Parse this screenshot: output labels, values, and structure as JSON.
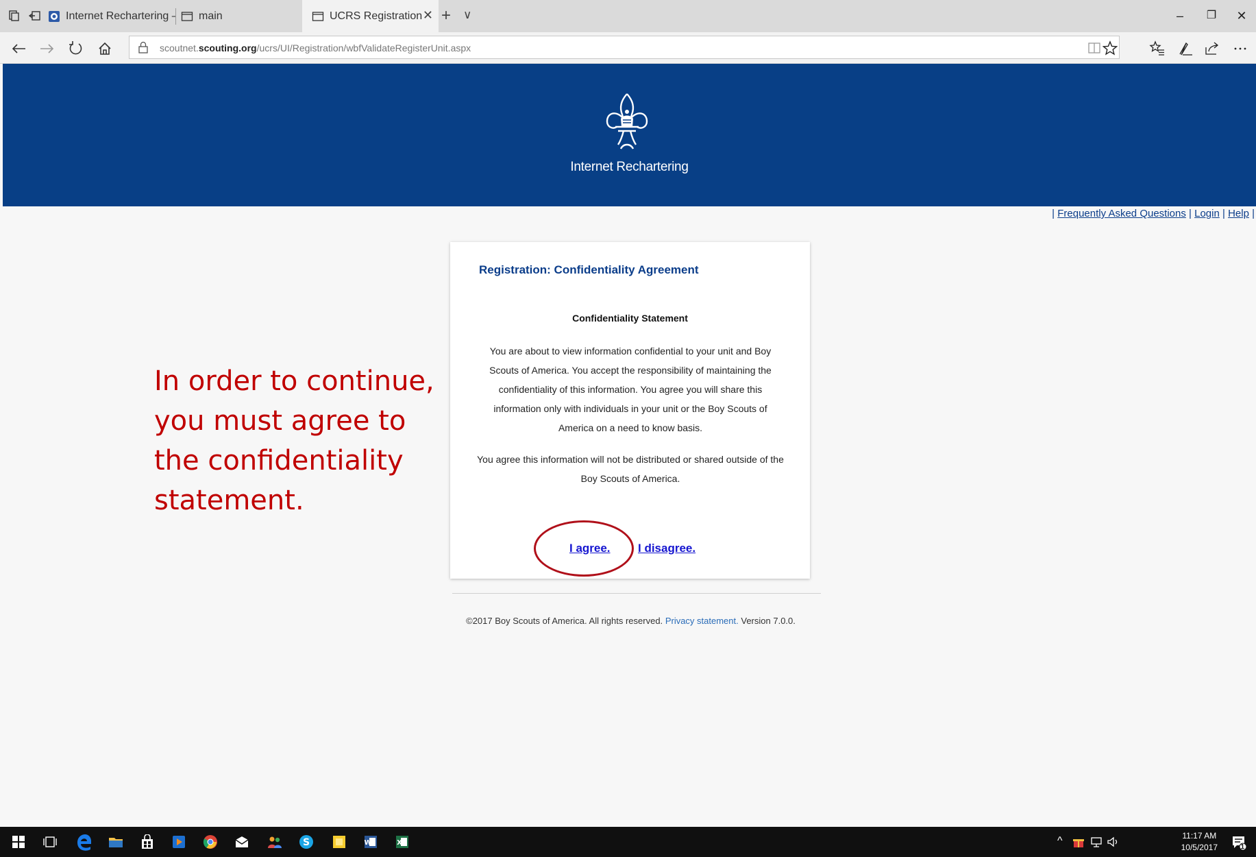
{
  "browser": {
    "tabs": [
      {
        "label": "Internet Rechartering – Grea",
        "active": false
      },
      {
        "label": "main",
        "active": false
      },
      {
        "label": "UCRS Registration",
        "active": true
      }
    ],
    "url_prefix": "scoutnet.",
    "url_domain": "scouting.org",
    "url_path": "/ucrs/UI/Registration/wbfValidateRegisterUnit.aspx",
    "window_buttons": {
      "minimize": "–",
      "restore": "❐",
      "close": "✕"
    },
    "new_tab": "+",
    "tab_list": "∨",
    "close_tab": "✕"
  },
  "site": {
    "title": "Internet Rechartering",
    "brand_color": "#083f86"
  },
  "toplinks": {
    "sep": "|",
    "faq": "Frequently Asked Questions",
    "login": "Login",
    "help": "Help"
  },
  "annotation": {
    "text": "In order to continue, you must agree to the confidentiality statement.",
    "color": "#c00000"
  },
  "card": {
    "heading": "Registration: Confidentiality Agreement",
    "statement_heading": "Confidentiality Statement",
    "statement_1": "You are about to view information confidential to your unit and Boy Scouts of America. You accept the responsibility of maintaining the confidentiality of this information. You agree you will share this information only with individuals in your unit or the Boy Scouts of America on a need to know basis.",
    "statement_2": "You agree this information will not be distributed or shared outside of the Boy Scouts of America.",
    "agree_label": "I agree.",
    "disagree_label": "I disagree."
  },
  "footer": {
    "copyright": "©2017 Boy Scouts of America. All rights reserved.",
    "privacy_link": "Privacy statement.",
    "version": "Version 7.0.0."
  },
  "taskbar": {
    "time": "11:17 AM",
    "date": "10/5/2017",
    "notification_count": "1",
    "icons": [
      "windows-start-icon",
      "task-view-icon",
      "edge-icon",
      "file-explorer-icon",
      "store-icon",
      "media-player-icon",
      "chrome-icon",
      "mail-icon",
      "people-icon",
      "skype-icon",
      "sticky-notes-icon",
      "word-icon",
      "excel-icon"
    ]
  }
}
